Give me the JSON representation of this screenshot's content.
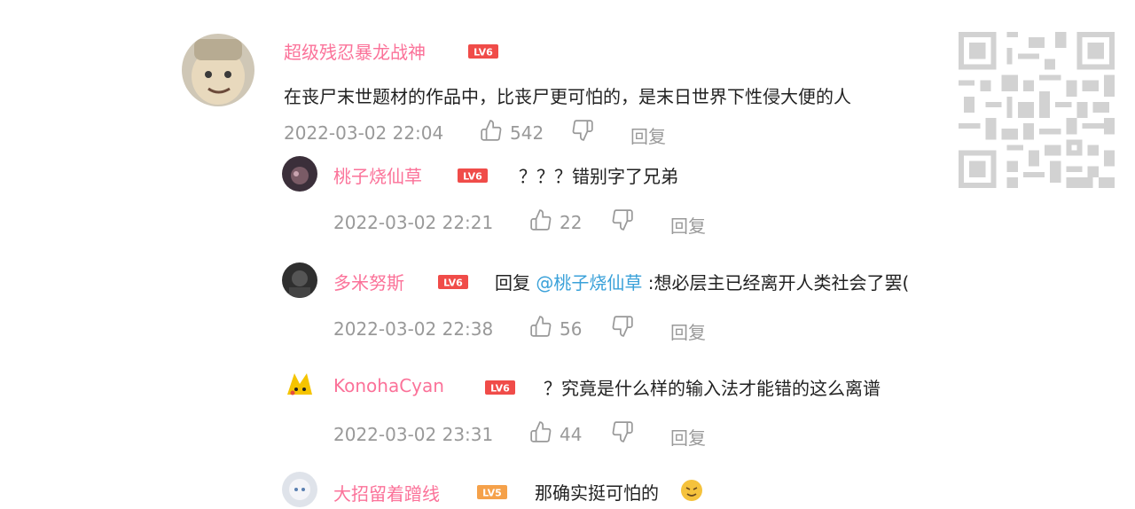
{
  "main_comment": {
    "username": "超级残忍暴龙战神",
    "level": "LV6",
    "text": "在丧尸末世题材的作品中，比丧尸更可怕的，是末日世界下性侵大便的人",
    "date": "2022-03-02 22:04",
    "likes": "542",
    "reply_label": "回复"
  },
  "replies": [
    {
      "username": "桃子烧仙草",
      "level": "LV6",
      "prefix": "",
      "mention": "",
      "text": "？？？错别字了兄弟",
      "date": "2022-03-02 22:21",
      "likes": "22",
      "reply_label": "回复"
    },
    {
      "username": "多米努斯",
      "level": "LV6",
      "prefix": "回复 ",
      "mention": "@桃子烧仙草",
      "text": " :想必层主已经离开人类社会了罢(",
      "date": "2022-03-02 22:38",
      "likes": "56",
      "reply_label": "回复"
    },
    {
      "username": "KonohaCyan",
      "level": "LV6",
      "prefix": "",
      "mention": "",
      "text": "？究竟是什么样的输入法才能错的这么离谱",
      "date": "2022-03-02 23:31",
      "likes": "44",
      "reply_label": "回复"
    },
    {
      "username": "大招留着蹭线",
      "level": "LV5",
      "prefix": "",
      "mention": "",
      "text": "那确实挺可怕的",
      "date": "",
      "likes": "",
      "reply_label": ""
    }
  ],
  "colors": {
    "username": "#fb7299",
    "meta": "#999999",
    "mention": "#3aa1d9",
    "level_badge": "#f04c49"
  },
  "icons": {
    "like": "thumbs-up-icon",
    "dislike": "thumbs-down-icon",
    "qr": "qr-code-icon",
    "emoji": "emoji-icon"
  }
}
